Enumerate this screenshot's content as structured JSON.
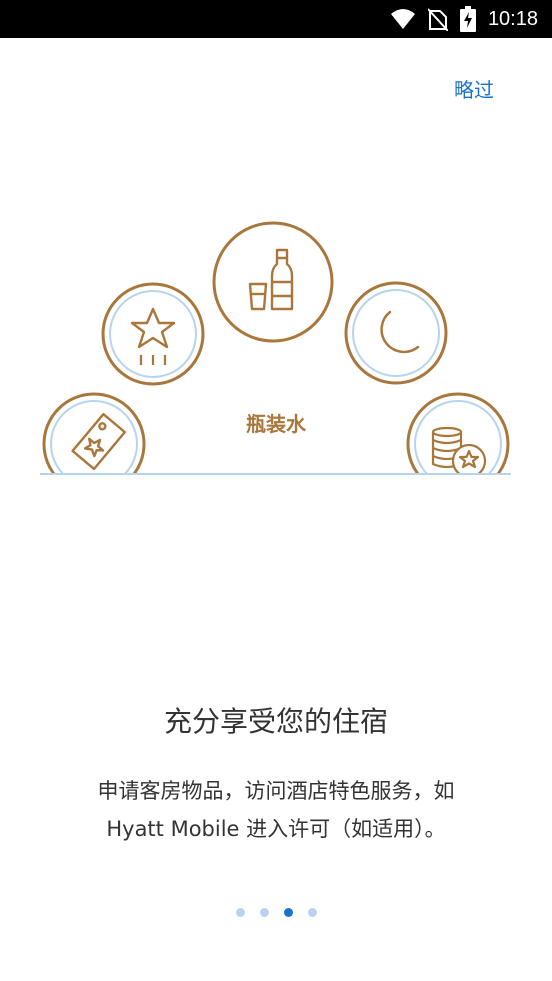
{
  "status_bar": {
    "time": "10:18",
    "icons": [
      "wifi-icon",
      "no-sim-icon",
      "battery-charging-icon"
    ]
  },
  "header": {
    "skip_label": "略过"
  },
  "carousel": {
    "center_label": "瓶装水",
    "items": [
      "tag-star-icon",
      "star-icon",
      "water-bottle-icon",
      "moon-icon",
      "coins-star-icon"
    ]
  },
  "main": {
    "title": "充分享受您的住宿",
    "description_line1": "申请客房物品，访问酒店特色服务，如",
    "description_line2": "Hyatt Mobile 进入许可（如适用）。"
  },
  "pager": {
    "total": 4,
    "active_index": 2
  },
  "colors": {
    "accent": "#1a73c8",
    "icon_brown": "#a9763b",
    "ring_blue": "#b7d3ee",
    "text": "#333333"
  }
}
